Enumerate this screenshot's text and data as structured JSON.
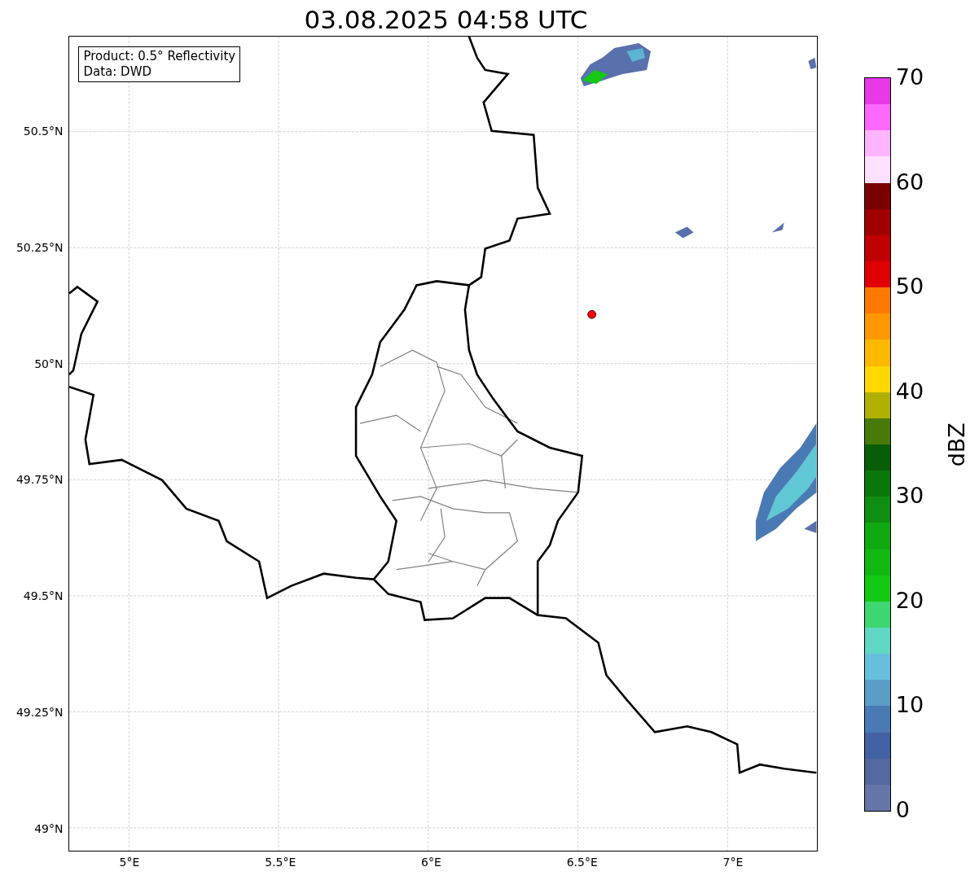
{
  "title": "03.08.2025 04:58 UTC",
  "info_box": {
    "lines": [
      "Product: 0.5° Reflectivity",
      "Data: DWD"
    ]
  },
  "map": {
    "latitude_labels": [
      "50.5°N",
      "50.25°N",
      "50°N",
      "49.75°N",
      "49.5°N",
      "49.25°N",
      "49°N"
    ],
    "longitude_labels": [
      "5°E",
      "5.5°E",
      "6°E",
      "6.5°E",
      "7°E"
    ]
  },
  "colorbar": {
    "label": "dBZ",
    "ticks": [
      "70",
      "60",
      "50",
      "40",
      "30",
      "20",
      "10",
      "0"
    ],
    "segments": [
      {
        "color": "#e838e8"
      },
      {
        "color": "#ff68ff"
      },
      {
        "color": "#ffb4ff"
      },
      {
        "color": "#ffe0ff"
      },
      {
        "color": "#780000"
      },
      {
        "color": "#a00000"
      },
      {
        "color": "#c00000"
      },
      {
        "color": "#e00000"
      },
      {
        "color": "#ff7800"
      },
      {
        "color": "#ff9800"
      },
      {
        "color": "#ffb800"
      },
      {
        "color": "#ffd800"
      },
      {
        "color": "#b0b000"
      },
      {
        "color": "#487a08"
      },
      {
        "color": "#075e07"
      },
      {
        "color": "#0a780a"
      },
      {
        "color": "#0e8e10"
      },
      {
        "color": "#10a810"
      },
      {
        "color": "#10b810"
      },
      {
        "color": "#12c812"
      },
      {
        "color": "#3ed670"
      },
      {
        "color": "#60d8c4"
      },
      {
        "color": "#66c0dc"
      },
      {
        "color": "#5a9ec8"
      },
      {
        "color": "#4a7ab4"
      },
      {
        "color": "#4260a2"
      },
      {
        "color": "#5468a0"
      },
      {
        "color": "#6676a8"
      }
    ]
  }
}
